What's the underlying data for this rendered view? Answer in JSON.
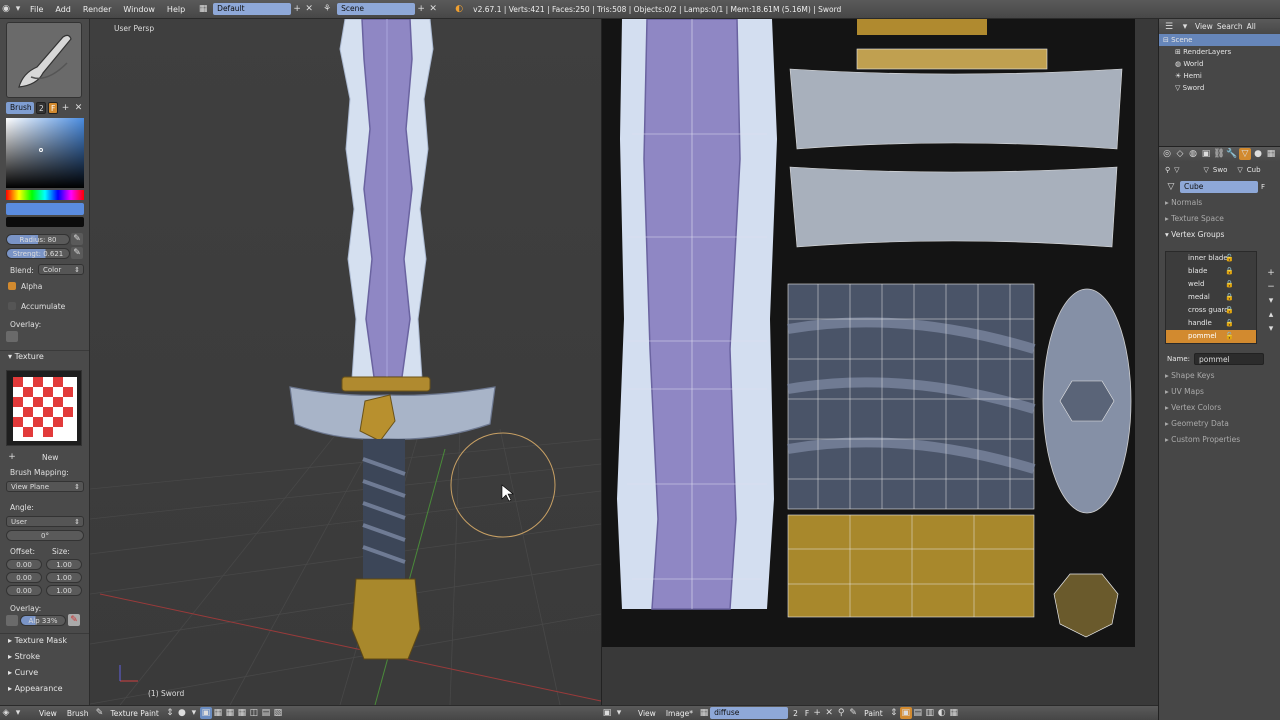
{
  "topbar": {
    "menus": [
      "File",
      "Add",
      "Render",
      "Window",
      "Help"
    ],
    "layout_value": "Default",
    "scene_value": "Scene",
    "stats": "v2.67.1 | Verts:421 | Faces:250 | Tris:508 | Objects:0/2 | Lamps:0/1 | Mem:18.61M (5.16M) | Sword"
  },
  "shelf": {
    "brush_label": "Brush",
    "brush_users": "2",
    "brush_fake": "F",
    "radius_label": "Radius: 80",
    "strength_label": "Strengt: 0.621",
    "blend_label": "Blend:",
    "blend_value": "Color",
    "alpha_label": "Alpha",
    "accumulate_label": "Accumulate",
    "overlay_label": "Overlay:",
    "texture_section": "Texture",
    "new_button": "New",
    "brush_mapping_label": "Brush Mapping:",
    "brush_mapping_value": "View Plane",
    "angle_label": "Angle:",
    "angle_mode": "User",
    "angle_value": "0°",
    "offset_label": "Offset:",
    "size_label": "Size:",
    "offset_x": "0.00",
    "offset_y": "0.00",
    "offset_z": "0.00",
    "size_x": "1.00",
    "size_y": "1.00",
    "size_z": "1.00",
    "overlay2_label": "Overlay:",
    "alpha_value": "Alp 33%",
    "sections": [
      "Texture Mask",
      "Stroke",
      "Curve",
      "Appearance"
    ]
  },
  "viewport": {
    "view_label": "User Persp",
    "object_label": "(1) Sword"
  },
  "bottom_left": {
    "menus": [
      "View",
      "Brush"
    ],
    "mode": "Texture Paint"
  },
  "bottom_right": {
    "menus": [
      "View",
      "Image*"
    ],
    "image_name": "diffuse",
    "image_users": "2",
    "image_fake": "F",
    "mode": "Paint"
  },
  "outliner": {
    "menus": [
      "View",
      "Search",
      "All"
    ],
    "items": [
      "Scene",
      "RenderLayers",
      "World",
      "Hemi",
      "Sword"
    ]
  },
  "properties": {
    "object_name": "Swo",
    "mesh_short": "Cub",
    "mesh_name": "Cube",
    "mesh_fake": "F",
    "sections_top": [
      "Normals",
      "Texture Space",
      "Vertex Groups"
    ],
    "vertex_groups": [
      "inner blade",
      "blade",
      "weld",
      "medal",
      "cross guard",
      "handle",
      "pommel"
    ],
    "name_label": "Name:",
    "name_value": "pommel",
    "sections_bottom": [
      "Shape Keys",
      "UV Maps",
      "Vertex Colors",
      "Geometry Data",
      "Custom Properties"
    ]
  },
  "colors": {
    "selection": "#d28a2f",
    "field_blue": "#8ea8d8",
    "blade": "#8f87c4",
    "gold": "#b08a2f"
  }
}
